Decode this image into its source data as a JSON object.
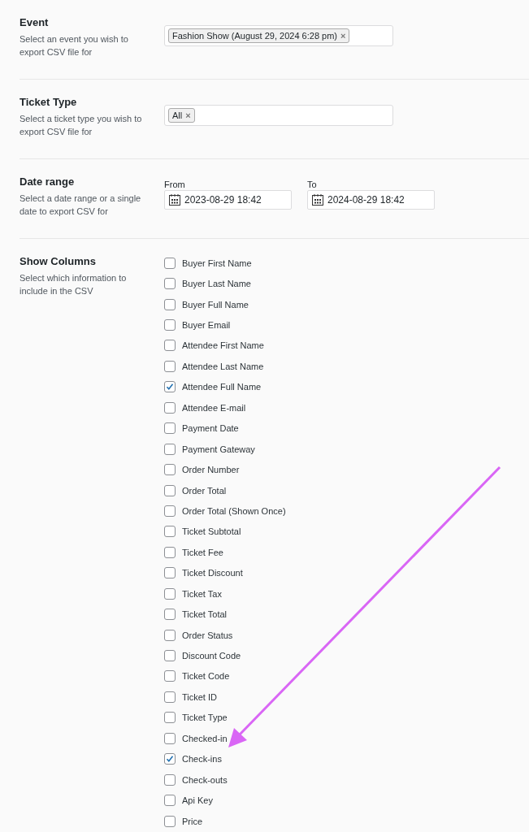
{
  "sections": [
    {
      "kind": "tags",
      "title": "Event",
      "description": "Select an event you wish to export CSV file for",
      "tags": [
        "Fashion Show (August 29, 2024 6:28 pm)"
      ],
      "remove": "×"
    },
    {
      "kind": "tags",
      "title": "Ticket Type",
      "description": "Select a ticket type you wish to export CSV file for",
      "tags": [
        "All"
      ],
      "remove": "×"
    },
    {
      "kind": "dates",
      "title": "Date range",
      "description": "Select a date range or a single date to export CSV for",
      "dates": [
        {
          "label": "From",
          "value": "2023-08-29 18:42"
        },
        {
          "label": "To",
          "value": "2024-08-29 18:42"
        }
      ]
    },
    {
      "kind": "checks",
      "title": "Show Columns",
      "description": "Select which information to include in the CSV",
      "options": [
        {
          "label": "Buyer First Name",
          "checked": false
        },
        {
          "label": "Buyer Last Name",
          "checked": false
        },
        {
          "label": "Buyer Full Name",
          "checked": false
        },
        {
          "label": "Buyer Email",
          "checked": false
        },
        {
          "label": "Attendee First Name",
          "checked": false
        },
        {
          "label": "Attendee Last Name",
          "checked": false
        },
        {
          "label": "Attendee Full Name",
          "checked": true
        },
        {
          "label": "Attendee E-mail",
          "checked": false
        },
        {
          "label": "Payment Date",
          "checked": false
        },
        {
          "label": "Payment Gateway",
          "checked": false
        },
        {
          "label": "Order Number",
          "checked": false
        },
        {
          "label": "Order Total",
          "checked": false
        },
        {
          "label": "Order Total (Shown Once)",
          "checked": false
        },
        {
          "label": "Ticket Subtotal",
          "checked": false
        },
        {
          "label": "Ticket Fee",
          "checked": false
        },
        {
          "label": "Ticket Discount",
          "checked": false
        },
        {
          "label": "Ticket Tax",
          "checked": false
        },
        {
          "label": "Ticket Total",
          "checked": false
        },
        {
          "label": "Order Status",
          "checked": false
        },
        {
          "label": "Discount Code",
          "checked": false
        },
        {
          "label": "Ticket Code",
          "checked": false
        },
        {
          "label": "Ticket ID",
          "checked": false
        },
        {
          "label": "Ticket Type",
          "checked": false
        },
        {
          "label": "Checked-in",
          "checked": false
        },
        {
          "label": "Check-ins",
          "checked": true
        },
        {
          "label": "Check-outs",
          "checked": false
        },
        {
          "label": "Api Key",
          "checked": false
        },
        {
          "label": "Price",
          "checked": false
        }
      ]
    }
  ]
}
